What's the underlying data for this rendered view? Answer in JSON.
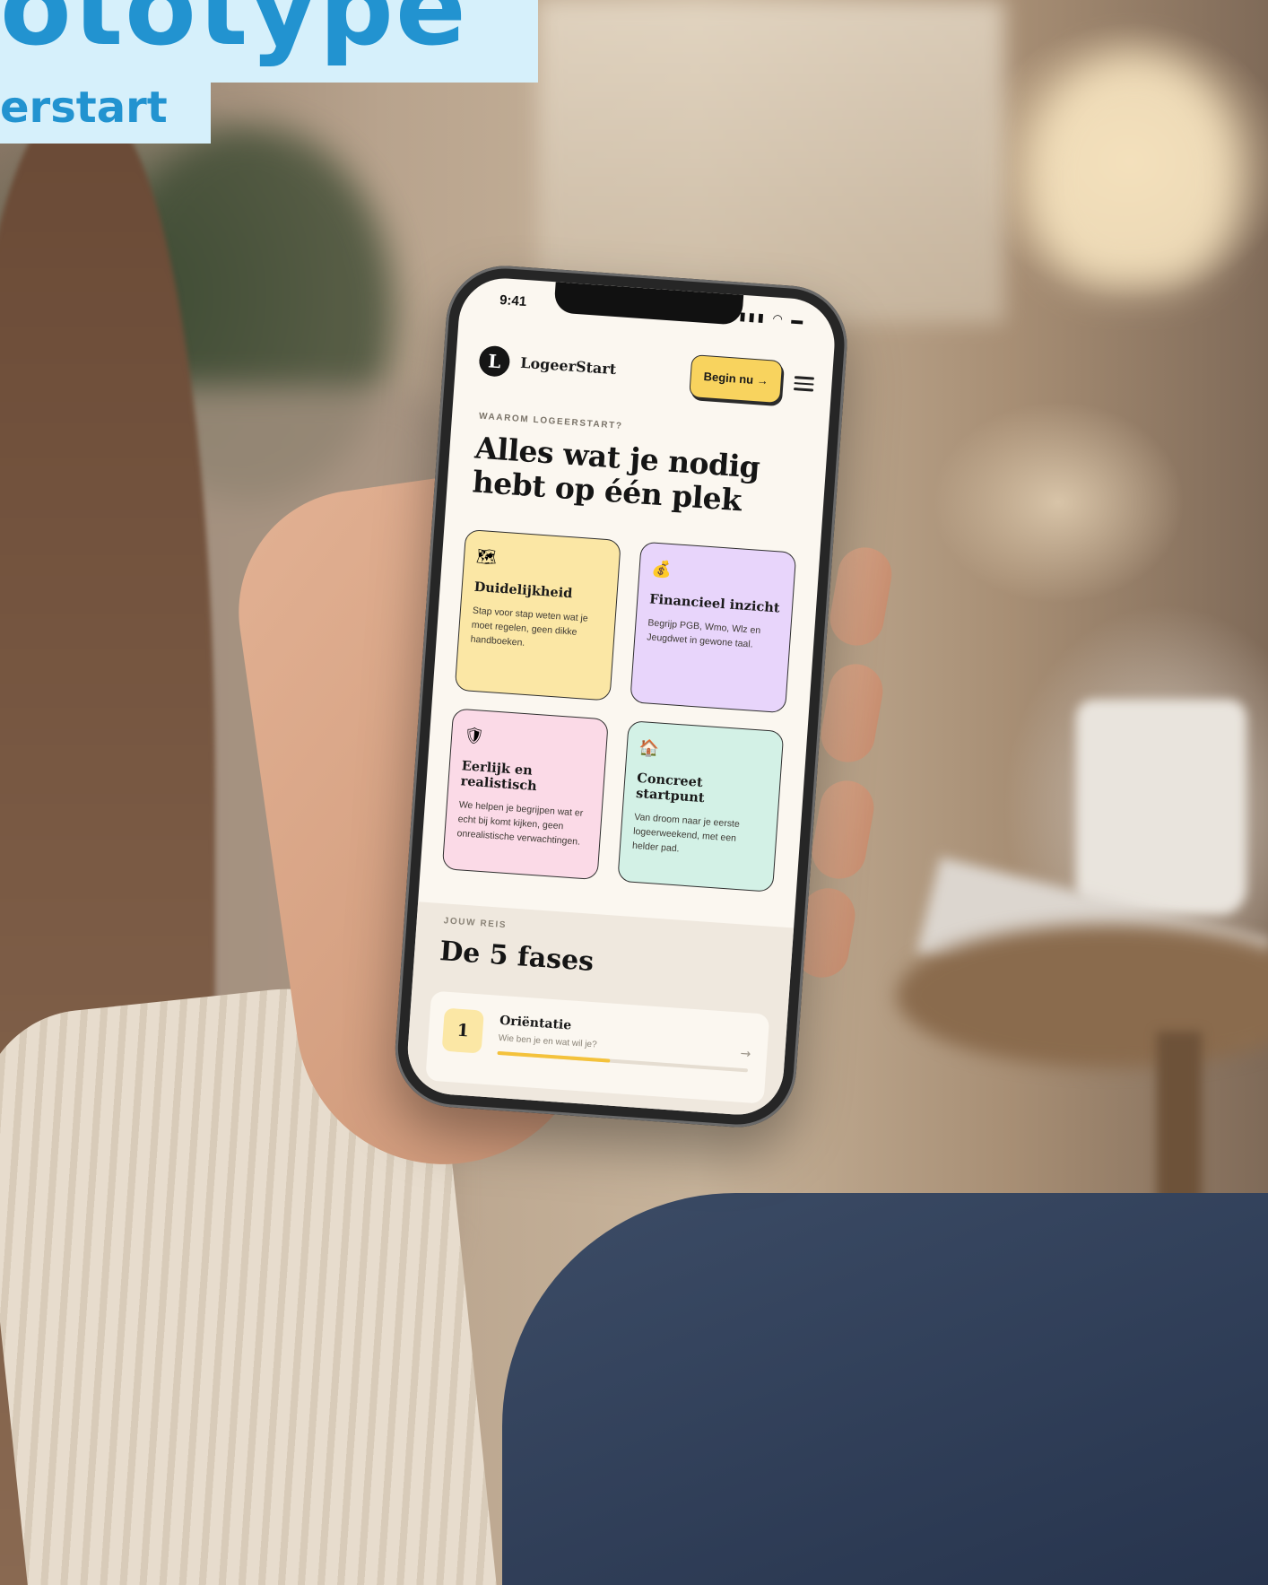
{
  "banner": {
    "title": "ototype",
    "subtitle": "erstart"
  },
  "status": {
    "time": "9:41",
    "icons": "▮▮▮ ◠ ▬"
  },
  "nav": {
    "logo_letter": "L",
    "logo_text": "LogeerStart",
    "cta_label": "Begin nu →"
  },
  "intro": {
    "eyebrow": "WAAROM LOGEERSTART?",
    "headline": "Alles wat je nodig hebt op één plek"
  },
  "cards": [
    {
      "icon": "🗺",
      "icon_name": "map-icon",
      "title": "Duidelijkheid",
      "desc": "Stap voor stap weten wat je moet regelen, geen dikke handboeken."
    },
    {
      "icon": "💰",
      "icon_name": "money-bag-icon",
      "title": "Financieel inzicht",
      "desc": "Begrijp PGB, Wmo, Wlz en Jeugdwet in gewone taal."
    },
    {
      "icon": "🛡",
      "icon_name": "shield-icon",
      "title": "Eerlijk en realistisch",
      "desc": "We helpen je begrijpen wat er echt bij komt kijken, geen onrealistische verwachtingen."
    },
    {
      "icon": "🏠",
      "icon_name": "house-icon",
      "title": "Concreet startpunt",
      "desc": "Van droom naar je eerste logeerweekend, met een helder pad."
    }
  ],
  "journey": {
    "eyebrow": "JOUW REIS",
    "title": "De 5 fases",
    "phase": {
      "number": "1",
      "title": "Oriëntatie",
      "subtitle": "Wie ben je en wat wil je?",
      "progress": 0.45,
      "arrow": "→"
    }
  },
  "colors": {
    "accent": "#f8d35e",
    "banner_text": "#2293d0",
    "banner_bg": "#d6f0fb"
  }
}
